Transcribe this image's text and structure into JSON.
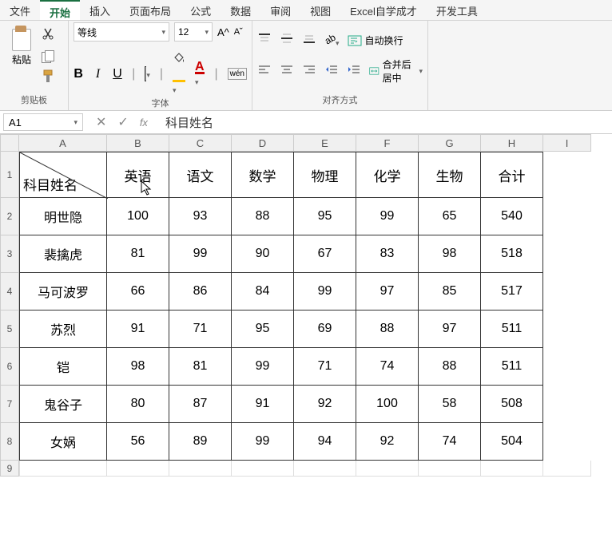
{
  "tabs": [
    "文件",
    "开始",
    "插入",
    "页面布局",
    "公式",
    "数据",
    "审阅",
    "视图",
    "Excel自学成才",
    "开发工具"
  ],
  "clipboard": {
    "paste": "粘贴",
    "group": "剪贴板"
  },
  "font": {
    "name": "等线",
    "size": "12",
    "group": "字体",
    "bold": "B",
    "italic": "I",
    "under": "U",
    "colorA": "A",
    "wen": "wén"
  },
  "align": {
    "group": "对齐方式",
    "wrap": "自动换行",
    "merge": "合并后居中"
  },
  "formula": {
    "cellref": "A1",
    "text": "科目姓名",
    "fx": "fx"
  },
  "columns": [
    "A",
    "B",
    "C",
    "D",
    "E",
    "F",
    "G",
    "H",
    "I"
  ],
  "rows": [
    "1",
    "2",
    "3",
    "4",
    "5",
    "6",
    "7",
    "8",
    "9"
  ],
  "chart_data": {
    "type": "table",
    "diag_label": "科目姓名",
    "headers": [
      "",
      "英语",
      "语文",
      "数学",
      "物理",
      "化学",
      "生物",
      "合计"
    ],
    "data": [
      {
        "name": "明世隐",
        "v": [
          "100",
          "93",
          "88",
          "95",
          "99",
          "65",
          "540"
        ]
      },
      {
        "name": "裴擒虎",
        "v": [
          "81",
          "99",
          "90",
          "67",
          "83",
          "98",
          "518"
        ]
      },
      {
        "name": "马可波罗",
        "v": [
          "66",
          "86",
          "84",
          "99",
          "97",
          "85",
          "517"
        ]
      },
      {
        "name": "苏烈",
        "v": [
          "91",
          "71",
          "95",
          "69",
          "88",
          "97",
          "511"
        ]
      },
      {
        "name": "铠",
        "v": [
          "98",
          "81",
          "99",
          "71",
          "74",
          "88",
          "511"
        ]
      },
      {
        "name": "鬼谷子",
        "v": [
          "80",
          "87",
          "91",
          "92",
          "100",
          "58",
          "508"
        ]
      },
      {
        "name": "女娲",
        "v": [
          "56",
          "89",
          "99",
          "94",
          "92",
          "74",
          "504"
        ]
      }
    ]
  }
}
